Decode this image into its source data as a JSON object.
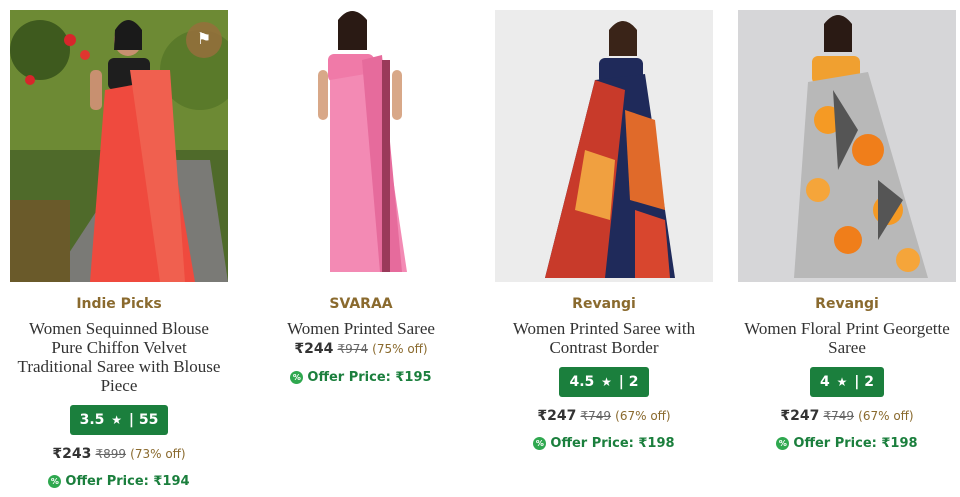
{
  "products": [
    {
      "brand": "Indie Picks",
      "title": "Women Sequinned Blouse Pure Chiffon Velvet Traditional Saree with Blouse Piece",
      "rating": "3.5",
      "reviews": "55",
      "price": "₹243",
      "mrp": "₹899",
      "discount": "(73% off)",
      "offer": "Offer Price: ₹194",
      "badge_icon": "tag-icon"
    },
    {
      "brand": "SVARAA",
      "title": "Women Printed Saree",
      "price": "₹244",
      "mrp": "₹974",
      "discount": "(75% off)",
      "offer": "Offer Price: ₹195"
    },
    {
      "brand": "Revangi",
      "title": "Women Printed Saree with Contrast Border",
      "rating": "4.5",
      "reviews": "2",
      "price": "₹247",
      "mrp": "₹749",
      "discount": "(67% off)",
      "offer": "Offer Price: ₹198"
    },
    {
      "brand": "Revangi",
      "title": "Women Floral Print Georgette Saree",
      "rating": "4",
      "reviews": "2",
      "price": "₹247",
      "mrp": "₹749",
      "discount": "(67% off)",
      "offer": "Offer Price: ₹198"
    }
  ],
  "symbols": {
    "star": "★",
    "separator": "|",
    "offer_badge": "%"
  },
  "colors": {
    "brand": "#8a6a2e",
    "rating_bg": "#1b7f3d",
    "offer": "#1b7f3d"
  }
}
